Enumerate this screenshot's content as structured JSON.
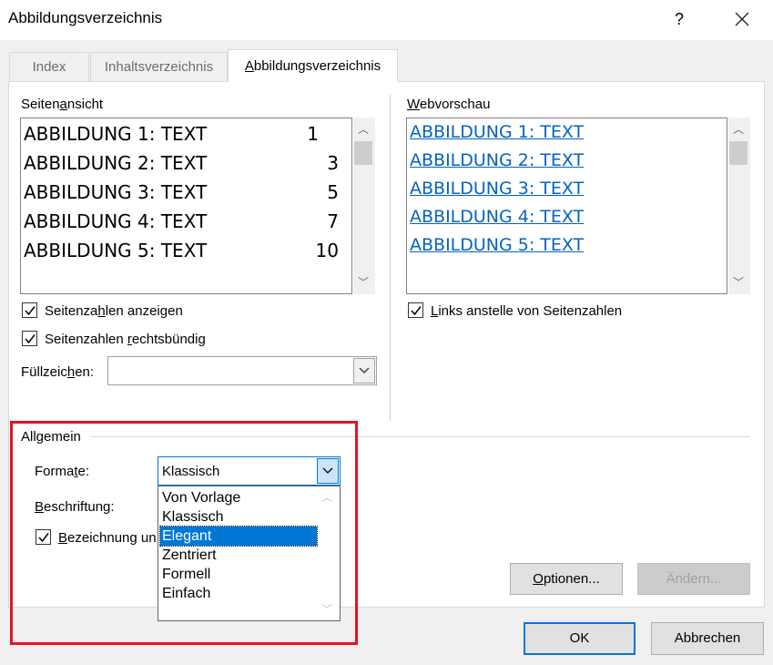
{
  "window": {
    "title": "Abbildungsverzeichnis",
    "help": "?"
  },
  "tabs": [
    {
      "label": "Index",
      "active": false
    },
    {
      "label": "Inhaltsverzeichnis",
      "active": false
    },
    {
      "label": "Abbildungsverzeichnis",
      "active": true
    }
  ],
  "print_preview": {
    "label": "Seitenansicht",
    "entries": [
      {
        "text": "ABBILDUNG 1: TEXT",
        "page": "1"
      },
      {
        "text": "ABBILDUNG 2: TEXT",
        "page": "3"
      },
      {
        "text": "ABBILDUNG 3: TEXT",
        "page": "5"
      },
      {
        "text": "ABBILDUNG 4: TEXT",
        "page": "7"
      },
      {
        "text": "ABBILDUNG 5: TEXT",
        "page": "10"
      }
    ],
    "show_page_numbers": {
      "label": "Seitenzahlen anzeigen",
      "checked": true
    },
    "right_align": {
      "label": "Seitenzahlen rechtsbündig",
      "checked": true
    },
    "tab_leader": {
      "label": "Füllzeichen:",
      "value": ""
    }
  },
  "web_preview": {
    "label": "Webvorschau",
    "entries": [
      "ABBILDUNG 1: TEXT",
      "ABBILDUNG 2: TEXT",
      "ABBILDUNG 3: TEXT",
      "ABBILDUNG 4: TEXT",
      "ABBILDUNG 5: TEXT"
    ],
    "use_hyperlinks": {
      "label": "Links anstelle von Seitenzahlen",
      "checked": true
    }
  },
  "general": {
    "label": "Allgemein",
    "formats": {
      "label": "Formate:",
      "value": "Klassisch",
      "options": [
        "Von Vorlage",
        "Klassisch",
        "Elegant",
        "Zentriert",
        "Formell",
        "Einfach"
      ],
      "highlighted": "Elegant"
    },
    "caption": {
      "label": "Beschriftung:"
    },
    "include_label": {
      "label": "Bezeichnung un",
      "checked": true
    }
  },
  "buttons": {
    "options": "Optionen...",
    "modify": "Ändern...",
    "ok": "OK",
    "cancel": "Abbrechen"
  },
  "colors": {
    "accent": "#0078d7",
    "link": "#0563c1",
    "highlight_frame": "#e81123"
  }
}
